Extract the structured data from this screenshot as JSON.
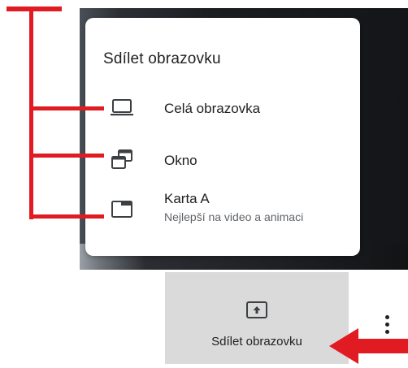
{
  "popup": {
    "title": "Sdílet obrazovku",
    "items": [
      {
        "label": "Celá obrazovka",
        "sublabel": ""
      },
      {
        "label": "Okno",
        "sublabel": ""
      },
      {
        "label": "Karta A",
        "sublabel": "Nejlepší na video a animaci"
      }
    ]
  },
  "toolbar": {
    "share_label": "Sdílet obrazovku"
  },
  "icons": {
    "entire_screen": "laptop-icon",
    "window": "window-icon",
    "tab": "browser-tab-icon",
    "present": "present-screen-icon",
    "more": "more-vert-icon"
  },
  "colors": {
    "annotation": "#e11b22",
    "toolbar_button_bg": "#dadada",
    "icon": "#3c4043"
  }
}
